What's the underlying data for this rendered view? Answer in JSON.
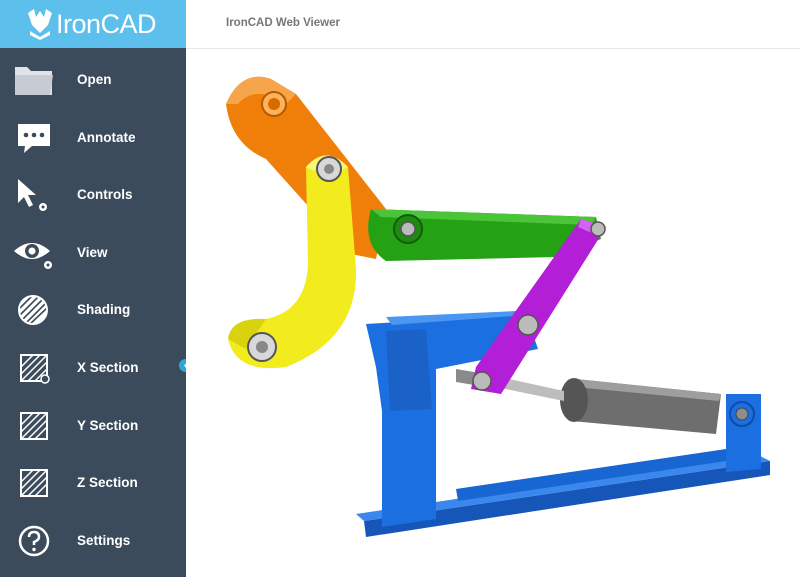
{
  "app": {
    "logo_text": "IronCAD",
    "brand_color": "#5dc0ec",
    "sidebar_color": "#3b4b5c"
  },
  "header": {
    "title": "IronCAD Web Viewer"
  },
  "sidebar": {
    "items": [
      {
        "label": "Open",
        "icon": "folder-icon"
      },
      {
        "label": "Annotate",
        "icon": "speech-bubble-icon"
      },
      {
        "label": "Controls",
        "icon": "cursor-icon"
      },
      {
        "label": "View",
        "icon": "eye-icon"
      },
      {
        "label": "Shading",
        "icon": "hatched-circle-icon"
      },
      {
        "label": "X Section",
        "icon": "x-section-icon"
      },
      {
        "label": "Y Section",
        "icon": "y-section-icon"
      },
      {
        "label": "Z Section",
        "icon": "z-section-icon"
      },
      {
        "label": "Settings",
        "icon": "help-circle-icon"
      }
    ],
    "collapse_glyph": "‹"
  },
  "model": {
    "part_colors": {
      "orange_link": "#f07f0a",
      "yellow_arm": "#f2ec1f",
      "green_link": "#25a114",
      "purple_link": "#b21fd6",
      "blue_base": "#1c6fe0",
      "cylinder": "#707070"
    }
  }
}
